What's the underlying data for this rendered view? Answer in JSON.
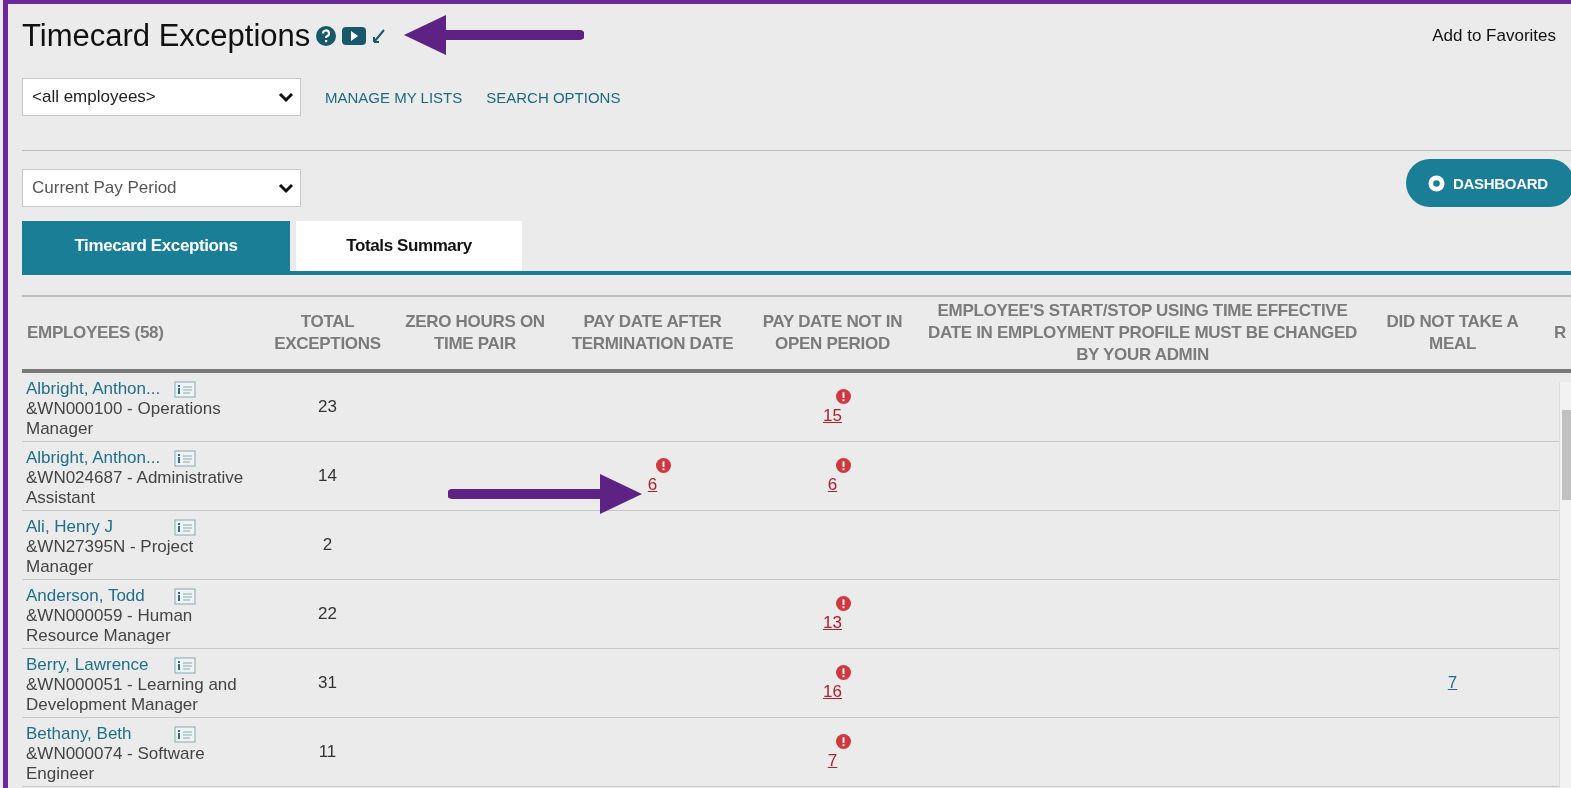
{
  "page": {
    "title": "Timecard Exceptions",
    "favorites_link": "Add to Favorites"
  },
  "employee_filter": {
    "value": "<all employees>"
  },
  "links": [
    "MANAGE MY LISTS",
    "SEARCH OPTIONS"
  ],
  "period_filter": {
    "value": "Current Pay Period"
  },
  "dashboard_button": "DASHBOARD",
  "tabs": [
    {
      "label": "Timecard Exceptions",
      "selected": true
    },
    {
      "label": "Totals Summary",
      "selected": false
    }
  ],
  "table": {
    "columns": [
      "EMPLOYEES (58)",
      "TOTAL EXCEPTIONS",
      "ZERO HOURS ON TIME PAIR",
      "PAY DATE AFTER TERMINATION DATE",
      "PAY DATE NOT IN OPEN PERIOD",
      "EMPLOYEE'S START/STOP USING TIME EFFECTIVE DATE IN EMPLOYMENT PROFILE MUST BE CHANGED BY YOUR ADMIN",
      "DID NOT TAKE A MEAL",
      "R"
    ],
    "rows": [
      {
        "cells": [
          {
            "name": "Albright, Anthon...",
            "detail": "&WN000100 - Operations Manager"
          },
          "23",
          "",
          "",
          {
            "text": "15",
            "alert": true
          },
          "",
          "",
          ""
        ]
      },
      {
        "cells": [
          {
            "name": "Albright, Anthon...",
            "detail": "&WN024687 - Administrative Assistant"
          },
          "14",
          "",
          {
            "text": "6",
            "alert": true
          },
          {
            "text": "6",
            "alert": true
          },
          "",
          "",
          ""
        ]
      },
      {
        "cells": [
          {
            "name": "Ali, Henry J",
            "detail": "&WN27395N - Project Manager"
          },
          "2",
          "",
          "",
          "",
          "",
          "",
          ""
        ]
      },
      {
        "cells": [
          {
            "name": "Anderson, Todd",
            "detail": "&WN000059 - Human Resource Manager"
          },
          "22",
          "",
          "",
          {
            "text": "13",
            "alert": true
          },
          "",
          "",
          ""
        ]
      },
      {
        "cells": [
          {
            "name": "Berry, Lawrence",
            "detail": "&WN000051 - Learning and Development Manager"
          },
          "31",
          "",
          "",
          {
            "text": "16",
            "alert": true
          },
          "",
          {
            "text": "7",
            "alert": false
          },
          ""
        ]
      },
      {
        "cells": [
          {
            "name": "Bethany, Beth",
            "detail": "&WN000074 - Software Engineer"
          },
          "11",
          "",
          "",
          {
            "text": "7",
            "alert": true
          },
          "",
          "",
          ""
        ]
      }
    ]
  }
}
